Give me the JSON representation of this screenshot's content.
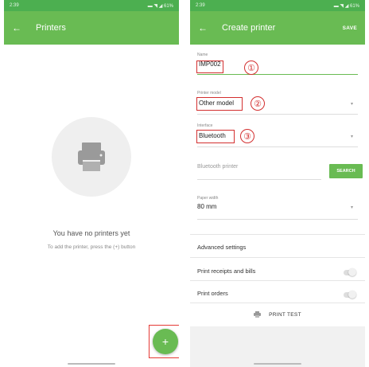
{
  "left": {
    "status": {
      "time": "2:39",
      "right": "▬ ◥ ◢ 61%"
    },
    "appbar": {
      "title": "Printers",
      "back": "←"
    },
    "empty": {
      "title": "You have no printers yet",
      "subtitle": "To add the printer, press the (+) button"
    },
    "fab": {
      "label": "+"
    }
  },
  "right": {
    "status": {
      "time": "2:39",
      "right": "▬ ◥ ◢ 61%"
    },
    "appbar": {
      "title": "Create printer",
      "back": "←",
      "save": "SAVE"
    },
    "name": {
      "label": "Name",
      "value": "IMP002",
      "marker": "①"
    },
    "model": {
      "label": "Printer model",
      "value": "Other model",
      "marker": "②"
    },
    "interface": {
      "label": "Interface",
      "value": "Bluetooth",
      "marker": "③"
    },
    "bluetooth": {
      "placeholder": "Bluetooth printer",
      "button": "SEARCH"
    },
    "paper": {
      "label": "Paper width",
      "value": "80 mm"
    },
    "advanced": "Advanced settings",
    "receipts": "Print receipts and bills",
    "orders": "Print orders",
    "print_test": "PRINT TEST",
    "caret": "▾"
  },
  "colors": {
    "green": "#69bb53",
    "status_green": "#4caf50",
    "annotation_red": "#d32f2f"
  }
}
